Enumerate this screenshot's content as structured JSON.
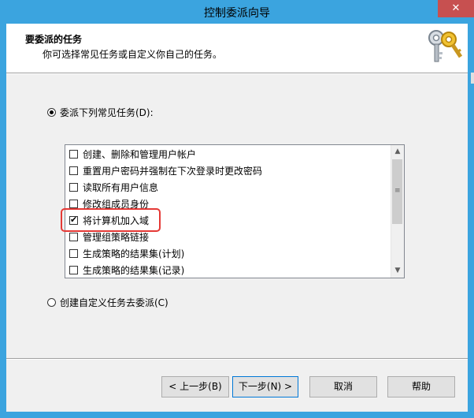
{
  "window": {
    "title": "控制委派向导",
    "close_glyph": "✕"
  },
  "header": {
    "heading": "要委派的任务",
    "subheading": "你可选择常见任务或自定义你自己的任务。",
    "icon": "keys-icon"
  },
  "options": {
    "common": {
      "label": "委派下列常见任务(D):",
      "selected": true
    },
    "custom": {
      "label": "创建自定义任务去委派(C)",
      "selected": false
    }
  },
  "tasks": [
    {
      "label": "创建、删除和管理用户帐户",
      "checked": false
    },
    {
      "label": "重置用户密码并强制在下次登录时更改密码",
      "checked": false
    },
    {
      "label": "读取所有用户信息",
      "checked": false
    },
    {
      "label": "修改组成员身份",
      "checked": false
    },
    {
      "label": "将计算机加入域",
      "checked": true
    },
    {
      "label": "管理组策略链接",
      "checked": false
    },
    {
      "label": "生成策略的结果集(计划)",
      "checked": false
    },
    {
      "label": "生成策略的结果集(记录)",
      "checked": false
    }
  ],
  "buttons": {
    "back": "< 上一步(B)",
    "next": "下一步(N) >",
    "cancel": "取消",
    "help": "帮助"
  },
  "colors": {
    "titlebar": "#3ba4df",
    "close": "#c75050",
    "highlight": "#e53935"
  }
}
